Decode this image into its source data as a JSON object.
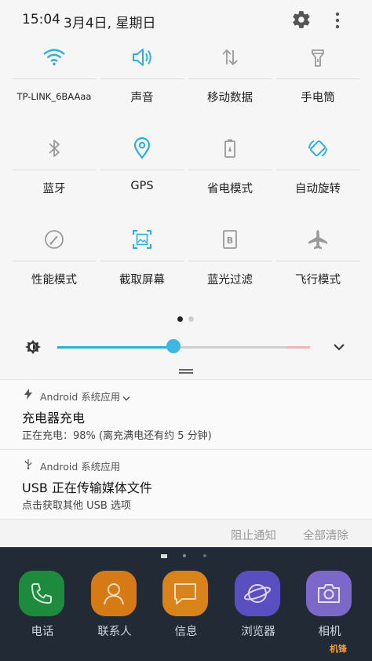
{
  "status_bar": {
    "time": "15:04",
    "date": "3月4日, 星期日"
  },
  "quick_settings": {
    "accent_active": "#2db0dc",
    "inactive_color": "#9a9a9a",
    "tiles": [
      {
        "label": "TP-LINK_6BAAaa",
        "icon": "wifi-icon",
        "active": true
      },
      {
        "label": "声音",
        "icon": "volume-icon",
        "active": true
      },
      {
        "label": "移动数据",
        "icon": "mobile-data-icon",
        "active": false
      },
      {
        "label": "手电筒",
        "icon": "flashlight-icon",
        "active": false
      },
      {
        "label": "蓝牙",
        "icon": "bluetooth-icon",
        "active": false
      },
      {
        "label": "GPS",
        "icon": "gps-icon",
        "active": true
      },
      {
        "label": "省电模式",
        "icon": "battery-saver-icon",
        "active": false
      },
      {
        "label": "自动旋转",
        "icon": "auto-rotate-icon",
        "active": true
      },
      {
        "label": "性能模式",
        "icon": "performance-icon",
        "active": false
      },
      {
        "label": "截取屏幕",
        "icon": "screenshot-icon",
        "active": true
      },
      {
        "label": "蓝光过滤",
        "icon": "blue-light-filter-icon",
        "active": false
      },
      {
        "label": "飞行模式",
        "icon": "airplane-icon",
        "active": false
      }
    ],
    "page_indicator": {
      "pages": 2,
      "current": 1
    },
    "brightness_level": 0.46
  },
  "notifications": [
    {
      "app": "Android 系统应用",
      "title": "充电器充电",
      "text": "正在充电：98% (离充满电还有约 5 分钟)"
    },
    {
      "app": "Android 系统应用",
      "title": "USB 正在传输媒体文件",
      "text": "点击获取其他 USB 选项"
    }
  ],
  "notification_actions": {
    "block": "阻止通知",
    "clear_all": "全部清除"
  },
  "dock": [
    {
      "label": "电话",
      "color": "#1d8a3e"
    },
    {
      "label": "联系人",
      "color": "#d57a14"
    },
    {
      "label": "信息",
      "color": "#d8841a"
    },
    {
      "label": "浏览器",
      "color": "#5a4fc0"
    },
    {
      "label": "相机",
      "color": "#7b68c8"
    }
  ],
  "watermark": "机锋"
}
